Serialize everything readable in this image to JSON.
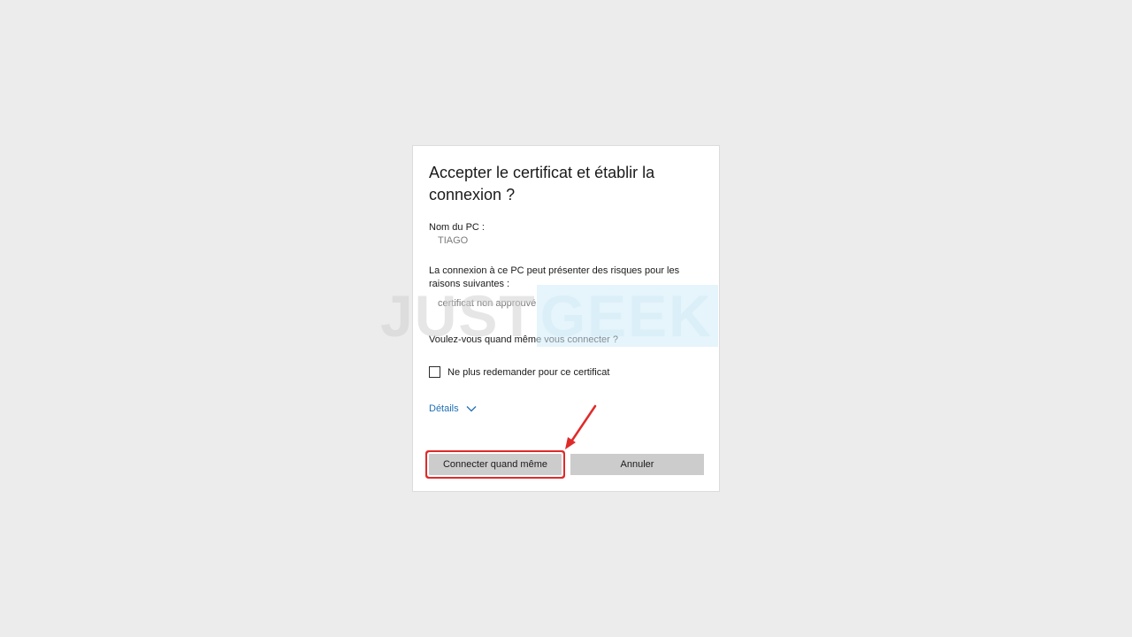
{
  "dialog": {
    "title": "Accepter le certificat et établir la connexion ?",
    "pc_name_label": "Nom du PC :",
    "pc_name_value": "TIAGO",
    "risk_text": "La connexion à ce PC peut présenter des risques pour les raisons suivantes :",
    "reason": "certificat non approuvé",
    "question": "Voulez-vous quand même vous connecter ?",
    "checkbox_label": "Ne plus redemander pour ce certificat",
    "checkbox_checked": false,
    "details_label": "Détails",
    "connect_button": "Connecter quand même",
    "cancel_button": "Annuler"
  },
  "watermark": {
    "part1": "JUST",
    "part2": "GEEK"
  },
  "colors": {
    "background": "#ececec",
    "link": "#1f6fb5",
    "button": "#cccccc",
    "highlight": "#e02a2a"
  },
  "icons": {
    "details_chevron": "chevron-down-icon",
    "annotation_arrow": "red-arrow-icon"
  }
}
